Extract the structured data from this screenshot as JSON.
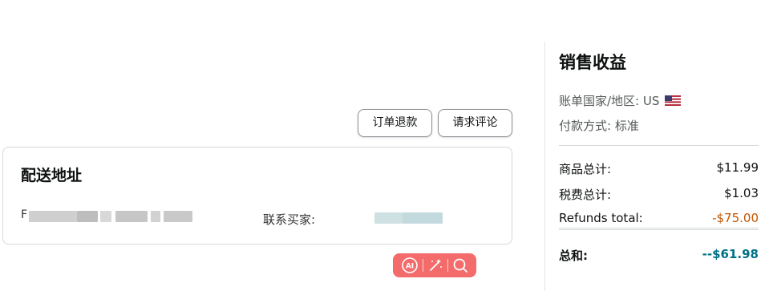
{
  "actions": {
    "refund_label": "订单退款",
    "review_label": "请求评论"
  },
  "shipping": {
    "title": "配送地址",
    "address_prefix": "F",
    "contact_label": "联系买家:"
  },
  "sales": {
    "title": "销售收益",
    "billing_country_label": "账单国家/地区: US",
    "payment_method_label": "付款方式: 标准",
    "rows": [
      {
        "label": "商品总计:",
        "value": "$11.99"
      },
      {
        "label": "税费总计:",
        "value": "$1.03"
      },
      {
        "label": "Refunds total:",
        "value": "-$75.00"
      }
    ],
    "total": {
      "label": "总和:",
      "value": "--$61.98"
    }
  },
  "icons": [
    "ai-icon",
    "magic-wand-icon",
    "search-icon",
    "us-flag-icon"
  ],
  "colors": {
    "refund_value": "#c45500",
    "total_value": "#007185",
    "ai_toolbar": "#f46b6b"
  }
}
